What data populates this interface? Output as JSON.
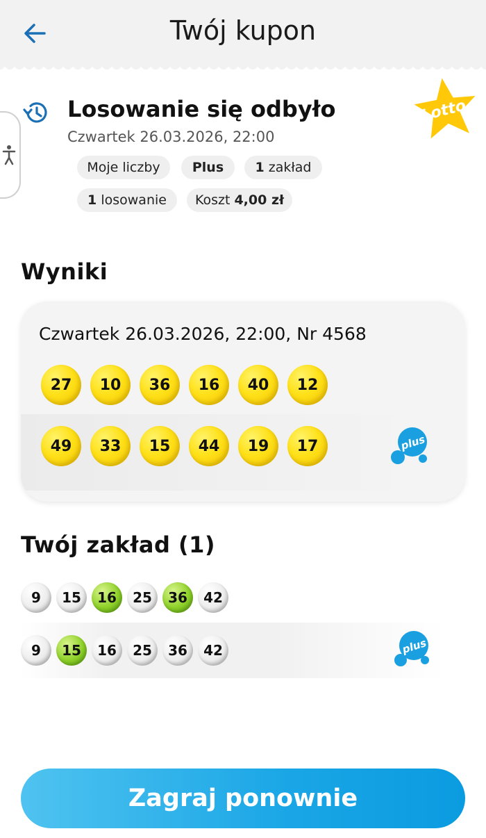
{
  "header": {
    "title": "Twój kupon"
  },
  "summary": {
    "status": "Losowanie się odbyło",
    "date": "Czwartek 26.03.2026, 22:00",
    "logo_text": "Lotto",
    "chips": {
      "numbers_type": "Moje liczby",
      "plus": "Plus",
      "bets_count": "1",
      "bets_label": "zakład",
      "draws_count": "1",
      "draws_label": "losowanie",
      "cost_label": "Koszt",
      "cost_value": "4,00 zł"
    }
  },
  "results": {
    "heading": "Wyniki",
    "draw_info": "Czwartek 26.03.2026, 22:00, Nr 4568",
    "lotto_numbers": [
      "27",
      "10",
      "36",
      "16",
      "40",
      "12"
    ],
    "plus_numbers": [
      "49",
      "33",
      "15",
      "44",
      "19",
      "17"
    ],
    "plus_logo_text": "plus"
  },
  "bet": {
    "heading": "Twój zakład (1)",
    "lotto_row": [
      {
        "n": "9",
        "hit": false
      },
      {
        "n": "15",
        "hit": false
      },
      {
        "n": "16",
        "hit": true
      },
      {
        "n": "25",
        "hit": false
      },
      {
        "n": "36",
        "hit": true
      },
      {
        "n": "42",
        "hit": false
      }
    ],
    "plus_row": [
      {
        "n": "9",
        "hit": false
      },
      {
        "n": "15",
        "hit": true
      },
      {
        "n": "16",
        "hit": false
      },
      {
        "n": "25",
        "hit": false
      },
      {
        "n": "36",
        "hit": false
      },
      {
        "n": "42",
        "hit": false
      }
    ],
    "plus_logo_text": "plus"
  },
  "cta": {
    "label": "Zagraj ponownie"
  },
  "colors": {
    "accent_blue": "#1aa6e6",
    "lotto_yellow": "#ffe11a",
    "hit_green": "#8fd12a",
    "icon_blue": "#1a6fb5"
  }
}
